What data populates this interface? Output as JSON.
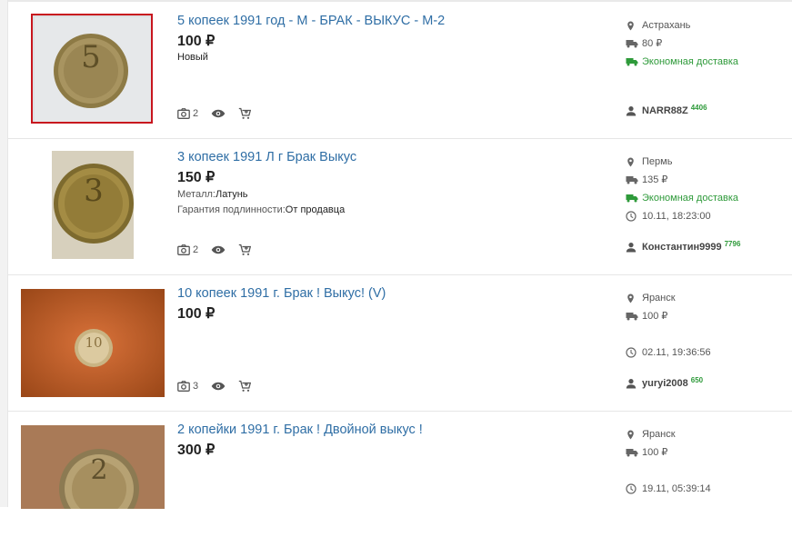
{
  "listings": [
    {
      "title": "5 копеек 1991 год - М - БРАК - ВЫКУС - М-2",
      "price": "100 ₽",
      "condition": "Новый",
      "photos": "2",
      "city": "Астрахань",
      "shipping": "80 ₽",
      "delivery": "Экономная доставка",
      "seller": "NARR88Z",
      "rating": "4406",
      "coin_text": "5"
    },
    {
      "title": "3 копеек 1991 Л г Брак Выкус",
      "price": "150 ₽",
      "attr1_label": "Металл:",
      "attr1_value": "Латунь",
      "attr2_label": "Гарантия подлинности:",
      "attr2_value": "От продавца",
      "photos": "2",
      "city": "Пермь",
      "shipping": "135 ₽",
      "delivery": "Экономная доставка",
      "date": "10.11, 18:23:00",
      "seller": "Константин9999",
      "rating": "7796",
      "coin_text": "3"
    },
    {
      "title": "10 копеек 1991 г. Брак ! Выкус! (V)",
      "price": "100 ₽",
      "photos": "3",
      "city": "Яранск",
      "shipping": "100 ₽",
      "date": "02.11, 19:36:56",
      "seller": "yuryi2008",
      "rating": "650",
      "coin_text": "10"
    },
    {
      "title": "2 копейки 1991 г. Брак ! Двойной выкус !",
      "price": "300 ₽",
      "city": "Яранск",
      "shipping": "100 ₽",
      "date": "19.11, 05:39:14",
      "coin_text": "2"
    }
  ],
  "colors": {
    "link": "#2f6ea5",
    "green": "#2e9a3a"
  }
}
